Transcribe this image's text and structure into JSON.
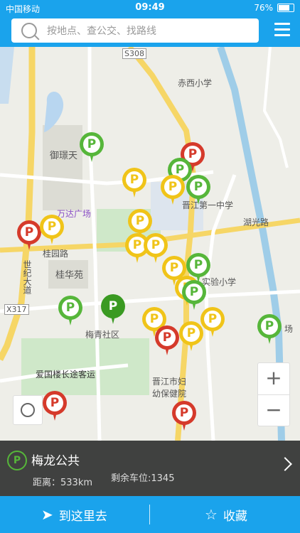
{
  "status_bar": {
    "carrier": "中国移动",
    "time": "09:49",
    "battery": "76%"
  },
  "search": {
    "placeholder": "按地点、查公交、找路线"
  },
  "map_labels": [
    {
      "key": "s308",
      "text": "S308"
    },
    {
      "key": "chixi",
      "text": "赤西小学"
    },
    {
      "key": "yuhuan",
      "text": "御璟天"
    },
    {
      "key": "jinjiang1",
      "text": "晋江第一中学"
    },
    {
      "key": "wanda",
      "text": "万达广场"
    },
    {
      "key": "guiyuan",
      "text": "桂园路"
    },
    {
      "key": "guihua",
      "text": "桂华苑"
    },
    {
      "key": "shiji",
      "text": "世纪大道"
    },
    {
      "key": "x317",
      "text": "X317"
    },
    {
      "key": "meiqing",
      "text": "梅青社区"
    },
    {
      "key": "aiguo",
      "text": "爱国楼长途客运"
    },
    {
      "key": "shiyan",
      "text": "实验小学"
    },
    {
      "key": "huguang",
      "text": "湖光路"
    },
    {
      "key": "fuyou",
      "text": "晋江市妇幼保健院"
    },
    {
      "key": "chang",
      "text": "场"
    }
  ],
  "info_card": {
    "name": "梅龙公共",
    "distance": "距离：533km",
    "spaces": "剩余车位:1345"
  },
  "bottom_bar": {
    "go": "到这里去",
    "favorite": "收藏"
  },
  "colors": {
    "primary": "#1aa3ec",
    "green": "#56b63a",
    "yellow": "#f0c419",
    "red": "#d53a2b"
  },
  "zoom": {
    "plus": "+",
    "minus": "−"
  },
  "pins": [
    {
      "color": "green"
    },
    {
      "color": "yellow"
    },
    {
      "color": "red"
    },
    {
      "color": "dark"
    }
  ]
}
